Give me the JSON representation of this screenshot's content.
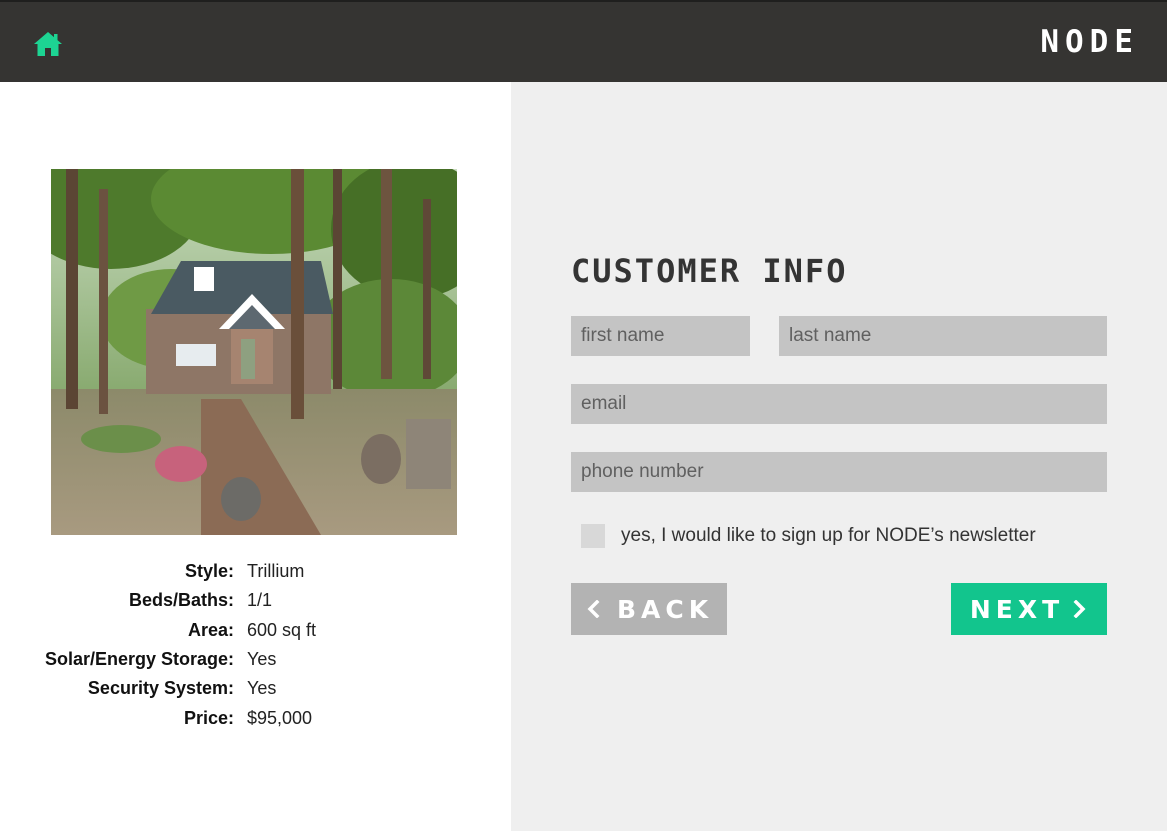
{
  "header": {
    "brand": "NODE",
    "home_icon": "home-icon",
    "accent_color": "#1dd493",
    "background_color": "#353432"
  },
  "listing": {
    "specs": [
      {
        "label": "Style:",
        "value": "Trillium"
      },
      {
        "label": "Beds/Baths:",
        "value": "1/1"
      },
      {
        "label": "Area:",
        "value": "600 sq ft"
      },
      {
        "label": "Solar/Energy Storage:",
        "value": "Yes"
      },
      {
        "label": "Security System:",
        "value": "Yes"
      },
      {
        "label": "Price:",
        "value": "$95,000"
      }
    ]
  },
  "form": {
    "title": "CUSTOMER INFO",
    "first_name_placeholder": "first name",
    "last_name_placeholder": "last name",
    "email_placeholder": "email",
    "phone_placeholder": "phone number",
    "newsletter_label": "yes, I would like to sign up for NODE’s newsletter",
    "back_label": "BACK",
    "next_label": "NEXT",
    "back_color": "#b3b3b3",
    "next_color": "#12c58d"
  }
}
